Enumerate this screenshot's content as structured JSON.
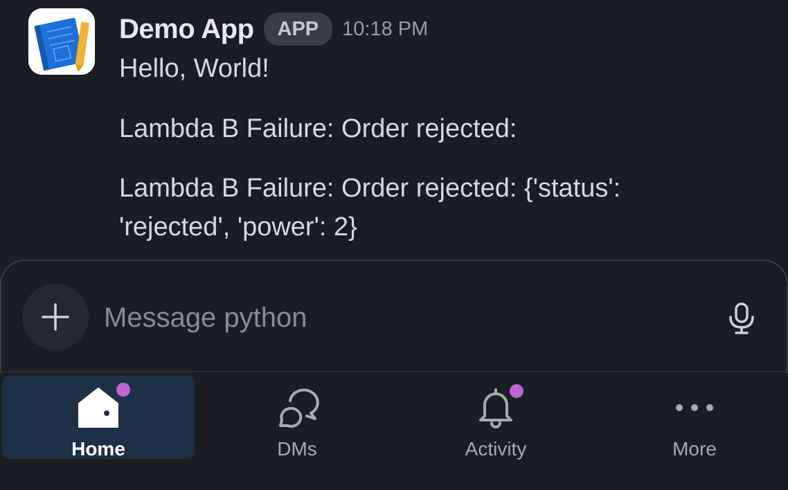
{
  "message": {
    "sender": "Demo App",
    "badge": "APP",
    "timestamp": "10:18 PM",
    "lines": [
      "Hello, World!",
      "Lambda B Failure: Order rejected:",
      "Lambda B Failure: Order rejected: {'status':",
      "'rejected', 'power': 2}"
    ],
    "avatar_icon": "notebook-pencil-icon"
  },
  "composer": {
    "placeholder": "Message python",
    "value": "",
    "add_icon": "plus-icon",
    "mic_icon": "microphone-icon"
  },
  "nav": {
    "items": [
      {
        "label": "Home",
        "icon": "home-icon",
        "active": true,
        "unread": true
      },
      {
        "label": "DMs",
        "icon": "chat-bubbles-icon",
        "active": false,
        "unread": false
      },
      {
        "label": "Activity",
        "icon": "bell-icon",
        "active": false,
        "unread": true
      },
      {
        "label": "More",
        "icon": "more-dots-icon",
        "active": false,
        "unread": false
      }
    ]
  },
  "colors": {
    "background": "#1a1d21",
    "active_nav": "#1e3047",
    "unread_dot": "#c064d3",
    "badge_bg": "#3a3d42"
  }
}
